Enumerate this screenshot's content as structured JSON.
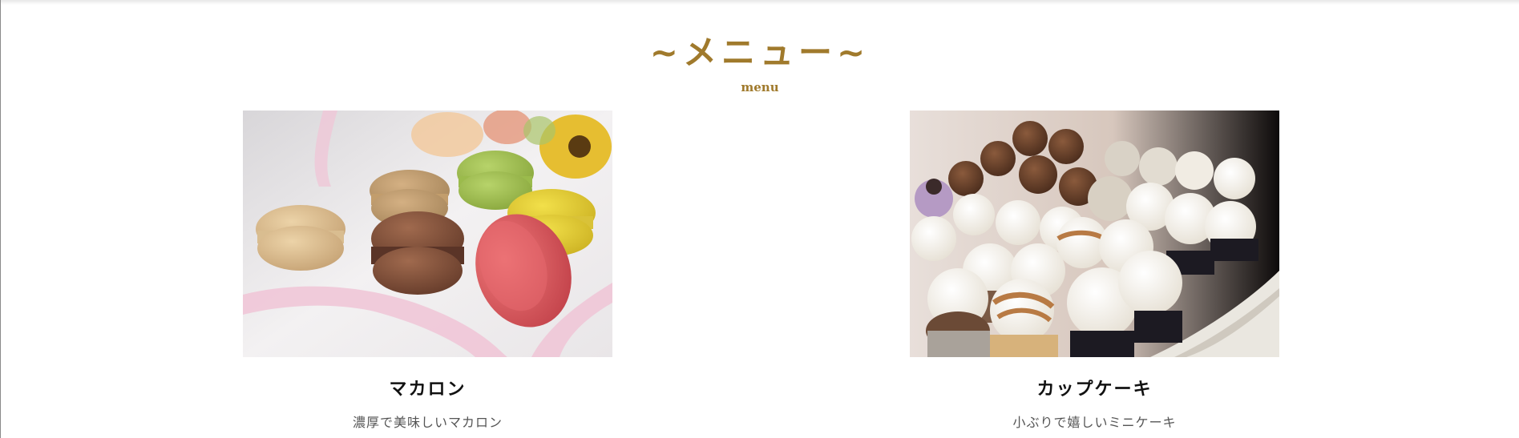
{
  "section": {
    "title": "~メニュー~",
    "subtitle": "menu",
    "accent_color": "#a07a2c"
  },
  "menu_items": [
    {
      "name": "マカロン",
      "description": "濃厚で美味しいマカロン",
      "image_icon": "macaron-photo"
    },
    {
      "name": "カップケーキ",
      "description": "小ぶりで嬉しいミニケーキ",
      "image_icon": "cupcake-photo"
    }
  ]
}
